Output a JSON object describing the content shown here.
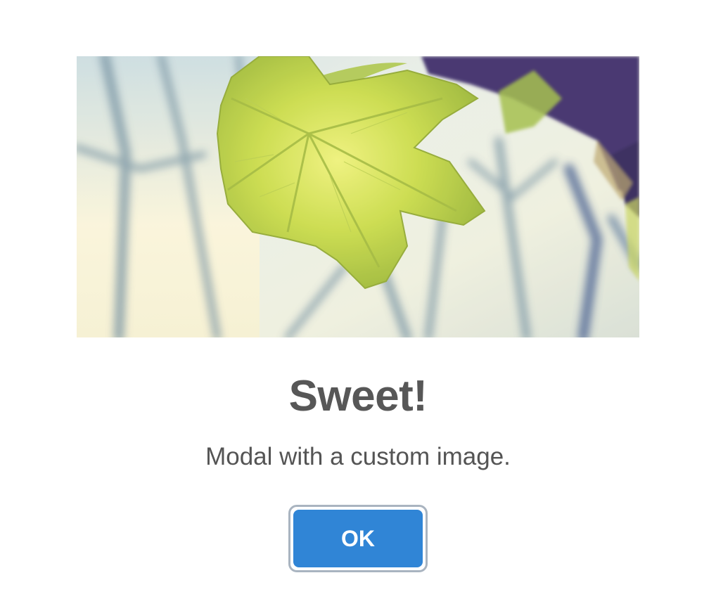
{
  "modal": {
    "title": "Sweet!",
    "text": "Modal with a custom image.",
    "confirm_label": "OK",
    "image_alt": "leaf-photo"
  },
  "colors": {
    "confirm_button": "#3085d6",
    "title": "#575757",
    "text": "#545454",
    "focus_ring": "#a9b4c0"
  }
}
